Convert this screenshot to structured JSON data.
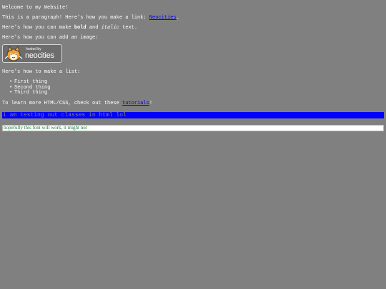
{
  "heading": "Welcome to my Website!",
  "paragraph_link": {
    "before": "This is a paragraph! Here's how you make a link: ",
    "link": "Neocities",
    "after": "."
  },
  "paragraph_format": {
    "before": "Here's how you can make ",
    "bold": "bold",
    "middle": " and ",
    "italic": "italic",
    "after": " text."
  },
  "paragraph_image": "Here's how you can add an image:",
  "badge": {
    "small_text": "hosted by",
    "big_text": "neocities",
    "icon": "neocities-cat-icon"
  },
  "paragraph_list": "Here's how to make a list:",
  "list": {
    "bullet": "•",
    "items": [
      "First thing",
      "Second thing",
      "Third thing"
    ]
  },
  "paragraph_learn": {
    "before": "To learn more HTML/CSS, check out these ",
    "link": "tutorials",
    "after": "!"
  },
  "blue_bar_text": "i am testing out classes in html lol",
  "white_bar_text": "hopefully this font will work, it might not",
  "colors": {
    "background": "#808080",
    "text": "#ffffff",
    "link": "#0000ee",
    "blue_bar": "#0000ff",
    "blue_bar_text": "#7f7f7f",
    "white_bar_text": "#1a7a3a"
  }
}
